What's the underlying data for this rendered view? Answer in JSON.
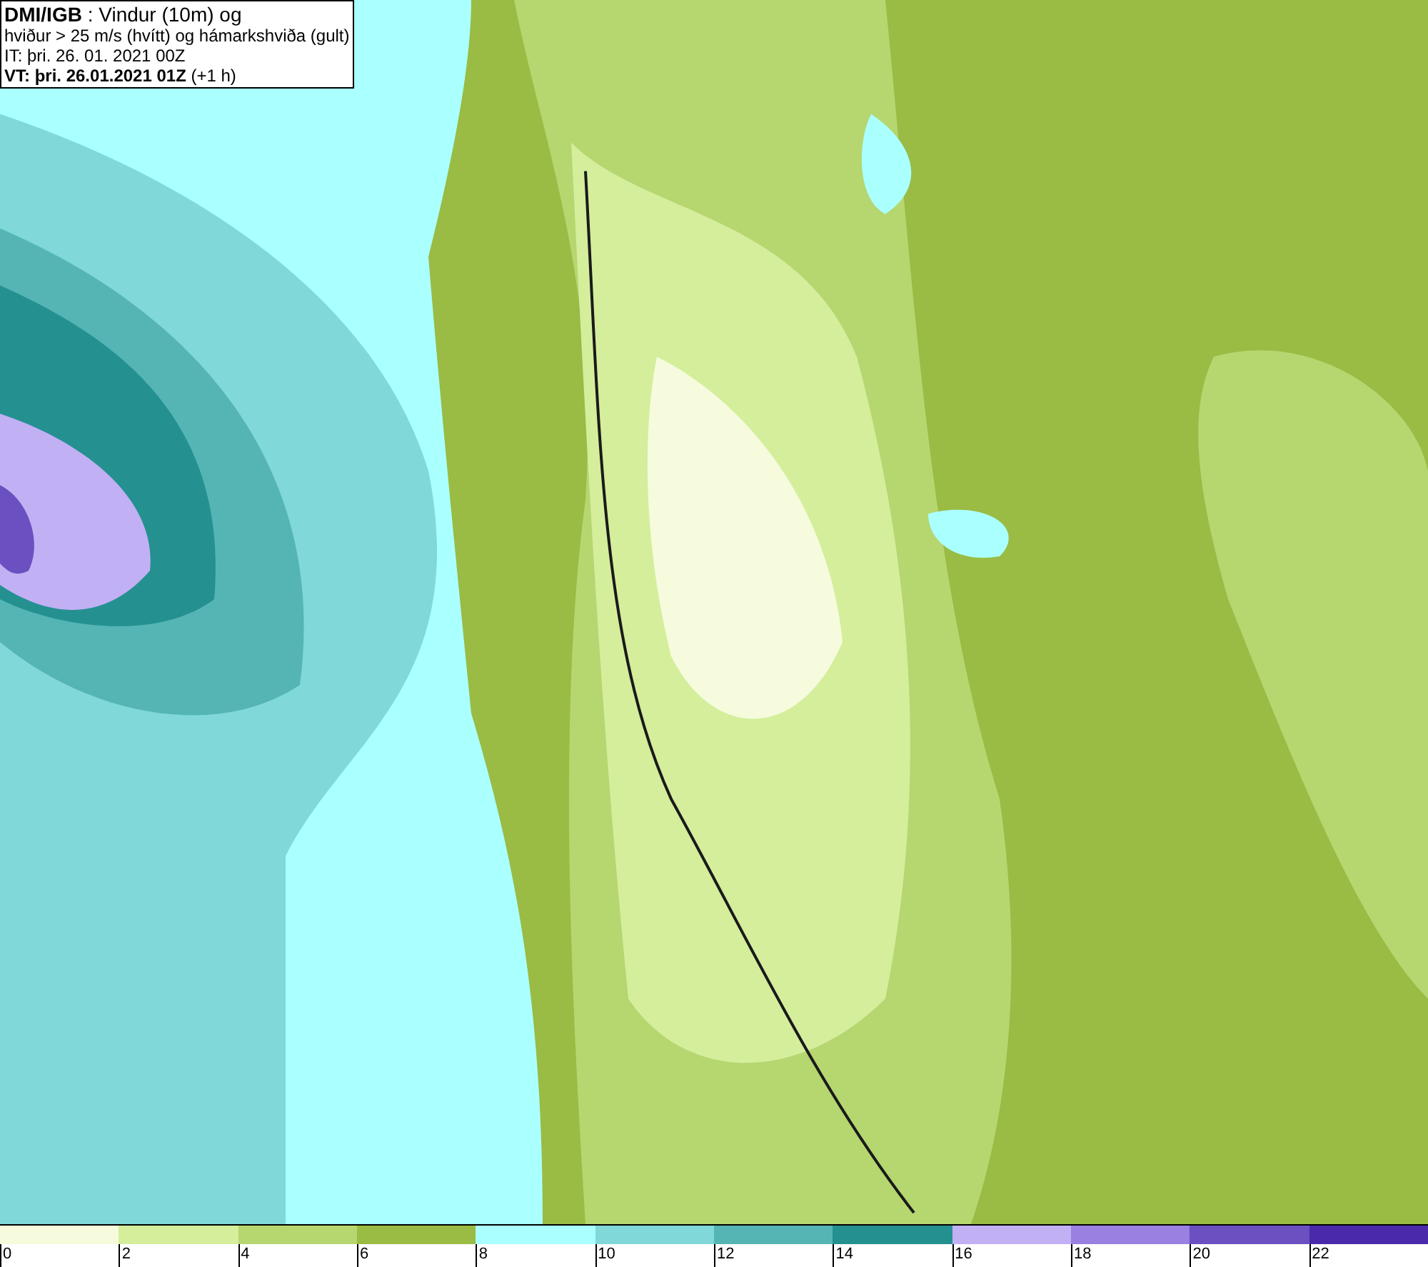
{
  "header": {
    "lines": [
      "**DMI/IGB** : Vindur (10m) og",
      "hviður > 25 m/s (hvítt) og hámarkshviða (gult)",
      "IT: þri. 26. 01. 2021 00Z",
      "**VT: þri. 26.01.2021 01Z** (+1 h)"
    ]
  },
  "legend": {
    "bins": [
      {
        "label": "0",
        "color": "#f5fbdc"
      },
      {
        "label": "2",
        "color": "#d4ee9c"
      },
      {
        "label": "4",
        "color": "#b6d670"
      },
      {
        "label": "6",
        "color": "#9abb44"
      },
      {
        "label": "8",
        "color": "#aaffff"
      },
      {
        "label": "10",
        "color": "#80d8d8"
      },
      {
        "label": "12",
        "color": "#55b5b5"
      },
      {
        "label": "14",
        "color": "#259090"
      },
      {
        "label": "16",
        "color": "#c2b0f5"
      },
      {
        "label": "18",
        "color": "#9a80e0"
      },
      {
        "label": "20",
        "color": "#6a50c0"
      },
      {
        "label": "22",
        "color": "#4a2aaa"
      }
    ]
  }
}
